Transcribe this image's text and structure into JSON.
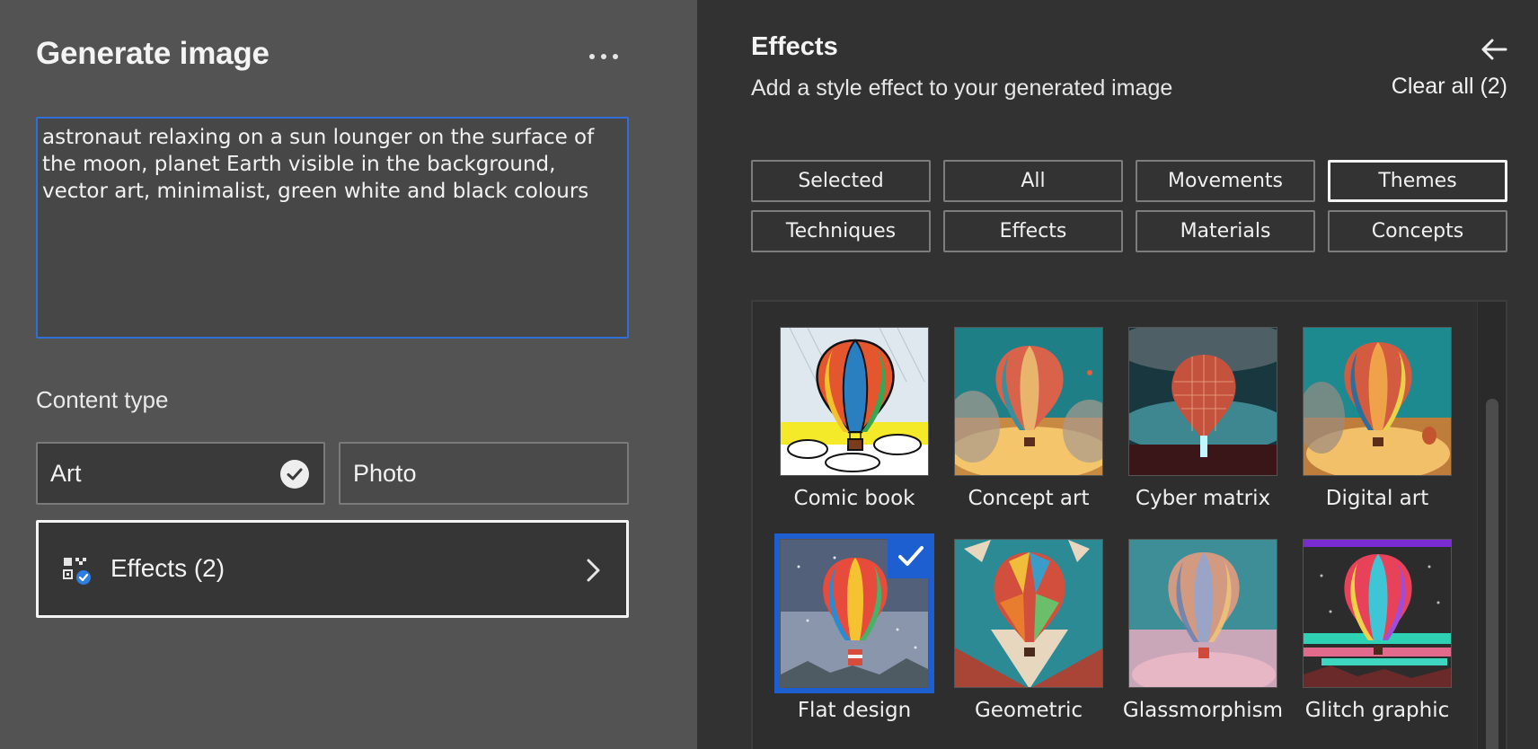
{
  "left": {
    "title": "Generate image",
    "more_icon": "ellipsis-icon",
    "prompt_value": "astronaut relaxing on a sun lounger on the surface of the moon, planet Earth visible in the background, vector art, minimalist, green white and black colours",
    "content_type_label": "Content type",
    "content_types": [
      {
        "label": "Art",
        "selected": true
      },
      {
        "label": "Photo",
        "selected": false
      }
    ],
    "effects_row_label": "Effects (2)"
  },
  "right": {
    "title": "Effects",
    "subtitle": "Add a style effect to your generated image",
    "clear_all": "Clear all (2)",
    "filters": [
      {
        "label": "Selected",
        "active": false
      },
      {
        "label": "All",
        "active": false
      },
      {
        "label": "Movements",
        "active": false
      },
      {
        "label": "Themes",
        "active": true
      },
      {
        "label": "Techniques",
        "active": false
      },
      {
        "label": "Effects",
        "active": false
      },
      {
        "label": "Materials",
        "active": false
      },
      {
        "label": "Concepts",
        "active": false
      }
    ],
    "effects": [
      {
        "label": "Comic book",
        "selected": false
      },
      {
        "label": "Concept art",
        "selected": false
      },
      {
        "label": "Cyber matrix",
        "selected": false
      },
      {
        "label": "Digital art",
        "selected": false
      },
      {
        "label": "Flat design",
        "selected": true
      },
      {
        "label": "Geometric",
        "selected": false
      },
      {
        "label": "Glassmorphism",
        "selected": false
      },
      {
        "label": "Glitch graphic",
        "selected": false
      }
    ]
  },
  "colors": {
    "accent": "#1d5fd1",
    "left_panel_bg": "#535353",
    "right_panel_bg": "#323232"
  }
}
